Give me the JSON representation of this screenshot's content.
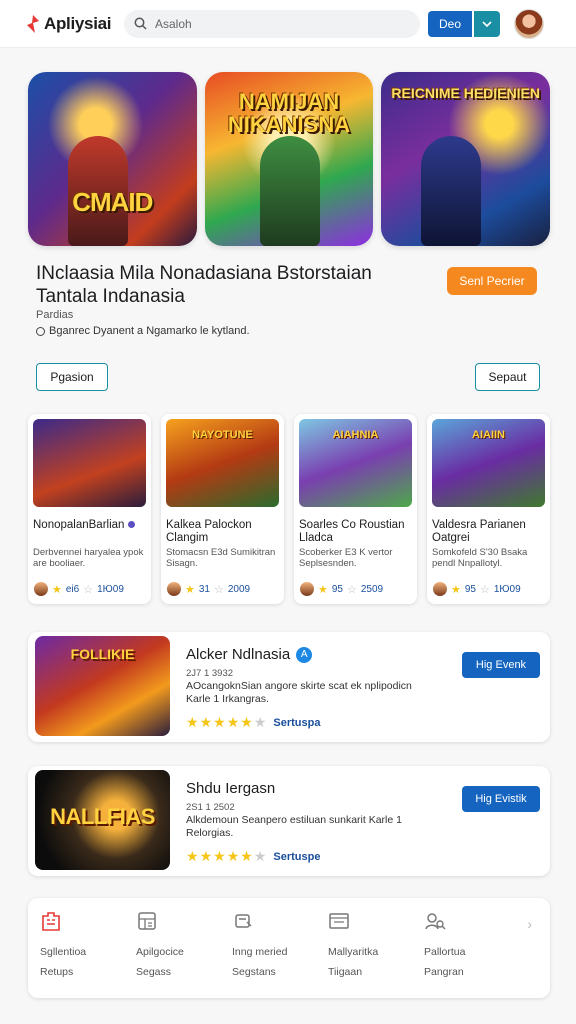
{
  "header": {
    "logo_text": "Apliysiai",
    "search_placeholder": "Asaloh",
    "dev_label": "Deo",
    "accent": "#1565c0"
  },
  "hero": {
    "images": [
      {
        "text": "CMAID"
      },
      {
        "text": "NAMIJAN NIKANISNA"
      },
      {
        "text": "REICNIME HEDIENIEN"
      }
    ]
  },
  "featured": {
    "title": "INclaasia Mila Nonadasiana Bstorstaian Tantala Indanasia",
    "cta_label": "Senl Pecrier",
    "sub": "Pardias",
    "desc": "Bganrec  Dyanent a Ngamarko le kytland.",
    "position_button": "Pgasion",
    "search_button": "Sepaut"
  },
  "grid_cards": [
    {
      "image_text": "",
      "title": "NonopalanBarlian",
      "desc": "Derbvennei haryalea ypok are booliaer.",
      "rating": "ei6",
      "count": "1Ю09"
    },
    {
      "image_text": "NAYOTUNE",
      "title": "Kalkea Palockon Clangim",
      "desc": "Stomacsn E3d Sumikitran Sisagn.",
      "rating": "31",
      "count": "2009"
    },
    {
      "image_text": "AIAHNIA",
      "title": "Soarles Co Roustian Lladca",
      "desc": "Scoberker E3 K vertor Seplsesnden.",
      "rating": "95",
      "count": "2509"
    },
    {
      "image_text": "AIAIIN",
      "title": "Valdesra Parianen Oatgrei",
      "desc": "Somkofeld S'30 Bsaka pendl Nnpallotyl.",
      "rating": "95",
      "count": "1Ю09"
    }
  ],
  "list_items": [
    {
      "image_text": "FOLLIKIE",
      "title": "Alcker Ndlnasia",
      "meta": "2J7 1 3932",
      "desc": "AOcangoknSian angore skirte scat ek nplipodicn Karle 1 Irkangras.",
      "rating_label": "Sertuspa",
      "button": "Hig Evenk",
      "has_badge": true
    },
    {
      "image_text": "NALLFIAS",
      "title": "Shdu Iergasn",
      "meta": "2S1 1 2502",
      "desc": "Alkdemoun Seanpero estiluan sunkarit Karle 1 Relorgias.",
      "rating_label": "Sertuspe",
      "button": "Hig Evistik",
      "has_badge": false
    }
  ],
  "bottom_nav": [
    {
      "icon": "home-icon",
      "line1": "Sgllentioa",
      "line2": "Retups"
    },
    {
      "icon": "apps-icon",
      "line1": "Apilgocice",
      "line2": "Segass"
    },
    {
      "icon": "cart-icon",
      "line1": "Inng meried",
      "line2": "Segstans"
    },
    {
      "icon": "book-icon",
      "line1": "Mallyaritka",
      "line2": "Tiigaan"
    },
    {
      "icon": "search-user-icon",
      "line1": "Pallortua",
      "line2": "Pangran"
    }
  ]
}
